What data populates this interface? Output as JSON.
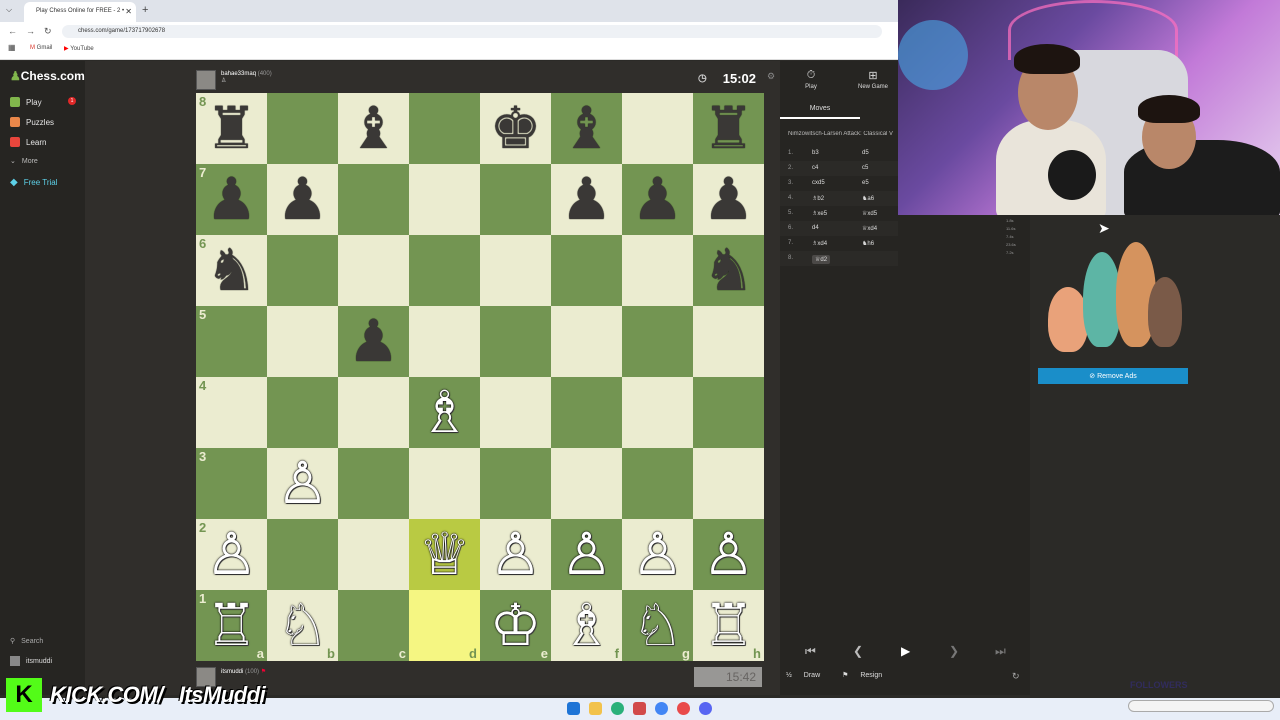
{
  "browser": {
    "tab_title": "Play Chess Online for FREE - 2 •",
    "url": "chess.com/game/173717902678",
    "bookmarks": [
      "Gmail",
      "YouTube"
    ]
  },
  "sidebar": {
    "logo": "Chess.com",
    "items": [
      {
        "label": "Play",
        "color": "#81b64c"
      },
      {
        "label": "Puzzles",
        "color": "#e9874a"
      },
      {
        "label": "Learn",
        "color": "#e8463c"
      },
      {
        "label": "More",
        "color": "#888888"
      },
      {
        "label": "Free Trial",
        "color": "#5dd1e8"
      }
    ],
    "play_badge": "1",
    "search": "Search",
    "username": "itsmuddi"
  },
  "top_player": {
    "name": "bahae33maq",
    "rating": "(400)",
    "clock": "15:02"
  },
  "bottom_player": {
    "name": "itsmuddi",
    "rating": "(100)",
    "clock": "15:42"
  },
  "board": {
    "ranks": [
      "8",
      "7",
      "6",
      "5",
      "4",
      "3",
      "2",
      "1"
    ],
    "files": [
      "a",
      "b",
      "c",
      "d",
      "e",
      "f",
      "g",
      "h"
    ],
    "rows": [
      [
        "♜",
        "",
        "♝",
        "",
        "♚",
        "♝",
        "",
        "♜"
      ],
      [
        "♟",
        "♟",
        "",
        "",
        "",
        "♟",
        "♟",
        "♟"
      ],
      [
        "♞",
        "",
        "",
        "",
        "",
        "",
        "",
        "♞"
      ],
      [
        "",
        "",
        "♟",
        "",
        "",
        "",
        "",
        ""
      ],
      [
        "",
        "",
        "",
        "♗",
        "",
        "",
        "",
        ""
      ],
      [
        "",
        "♙",
        "",
        "",
        "",
        "",
        "",
        ""
      ],
      [
        "♙",
        "",
        "",
        "♕",
        "♙",
        "♙",
        "♙",
        "♙"
      ],
      [
        "♖",
        "♘",
        "",
        "",
        "♔",
        "♗",
        "♘",
        "♖"
      ]
    ],
    "highlighted": [
      "d2",
      "d1"
    ]
  },
  "panel": {
    "play_label": "Play",
    "new_game_label": "New Game",
    "moves_tab": "Moves",
    "opening": "Nimzowitsch-Larsen Attack: Classical V",
    "moves": [
      {
        "n": "1.",
        "w": "b3",
        "b": "d5"
      },
      {
        "n": "2.",
        "w": "c4",
        "b": "c5"
      },
      {
        "n": "3.",
        "w": "cxd5",
        "b": "e5"
      },
      {
        "n": "4.",
        "w": "♗b2",
        "b": "♞a6"
      },
      {
        "n": "5.",
        "w": "♗xe5",
        "b": "♕xd5"
      },
      {
        "n": "6.",
        "w": "d4",
        "b": "♕xd4"
      },
      {
        "n": "7.",
        "w": "♗xd4",
        "b": "♞h6"
      },
      {
        "n": "8.",
        "w": "♕d2",
        "b": ""
      }
    ],
    "draw": "Draw",
    "resign": "Resign",
    "half": "½"
  },
  "move_times": [
    "1.8s",
    "11.6s",
    "7.4s",
    "23.6s",
    "7.2s"
  ],
  "ads": {
    "remove_ads": "Remove Ads"
  },
  "overlay": {
    "kick_url": "KICK.COM/",
    "kick_name": "ItsMuddi",
    "followers": "FOLLOWERS"
  }
}
